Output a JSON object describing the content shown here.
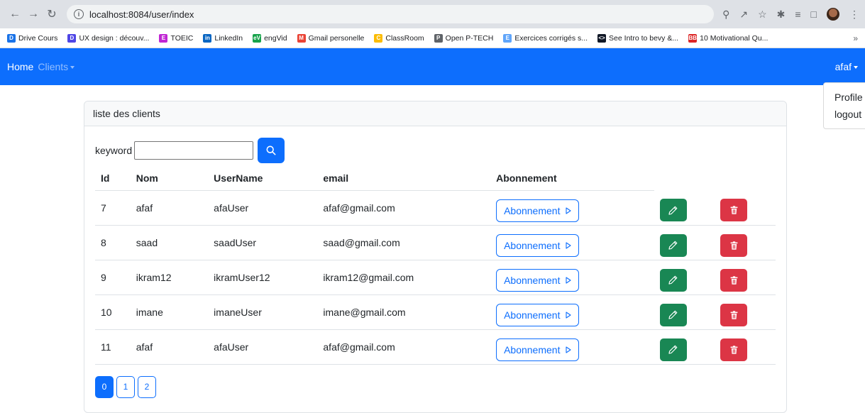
{
  "browser": {
    "url": "localhost:8084/user/index",
    "bookmarks": [
      {
        "label": "Drive Cours",
        "color": "#1a73e8",
        "icon": "D"
      },
      {
        "label": "UX design : découv...",
        "color": "#4f46e5",
        "icon": "D"
      },
      {
        "label": "TOEIC",
        "color": "#c026d3",
        "icon": "E"
      },
      {
        "label": "LinkedIn",
        "color": "#0a66c2",
        "icon": "in"
      },
      {
        "label": "engVid",
        "color": "#16a34a",
        "icon": "eV"
      },
      {
        "label": "Gmail personelle",
        "color": "#ea4335",
        "icon": "M"
      },
      {
        "label": "ClassRoom",
        "color": "#fbbc04",
        "icon": "C"
      },
      {
        "label": "Open P-TECH",
        "color": "#5f6368",
        "icon": "P"
      },
      {
        "label": "Exercices corrigés s...",
        "color": "#60a5fa",
        "icon": "E"
      },
      {
        "label": "See Intro to bevy &...",
        "color": "#111827",
        "icon": "<>"
      },
      {
        "label": "10 Motivational Qu...",
        "color": "#dc2626",
        "icon": "BB"
      }
    ],
    "bookmarks_more": "»"
  },
  "navbar": {
    "home": "Home",
    "clients": "Clients",
    "user": "afaf"
  },
  "dropdown": {
    "profile": "Profile",
    "logout": "logout"
  },
  "card": {
    "title": "liste des clients",
    "keyword_label": "keyword",
    "keyword_value": ""
  },
  "table": {
    "headers": {
      "id": "Id",
      "nom": "Nom",
      "username": "UserName",
      "email": "email",
      "abonnement": "Abonnement"
    },
    "rows": [
      {
        "id": "7",
        "nom": "afaf",
        "username": "afaUser",
        "email": "afaf@gmail.com",
        "abonnement": "Abonnement"
      },
      {
        "id": "8",
        "nom": "saad",
        "username": "saadUser",
        "email": "saad@gmail.com",
        "abonnement": "Abonnement"
      },
      {
        "id": "9",
        "nom": "ikram12",
        "username": "ikramUser12",
        "email": "ikram12@gmail.com",
        "abonnement": "Abonnement"
      },
      {
        "id": "10",
        "nom": "imane",
        "username": "imaneUser",
        "email": "imane@gmail.com",
        "abonnement": "Abonnement"
      },
      {
        "id": "11",
        "nom": "afaf",
        "username": "afaUser",
        "email": "afaf@gmail.com",
        "abonnement": "Abonnement"
      }
    ]
  },
  "pagination": {
    "pages": [
      "0",
      "1",
      "2"
    ],
    "current": "0"
  }
}
